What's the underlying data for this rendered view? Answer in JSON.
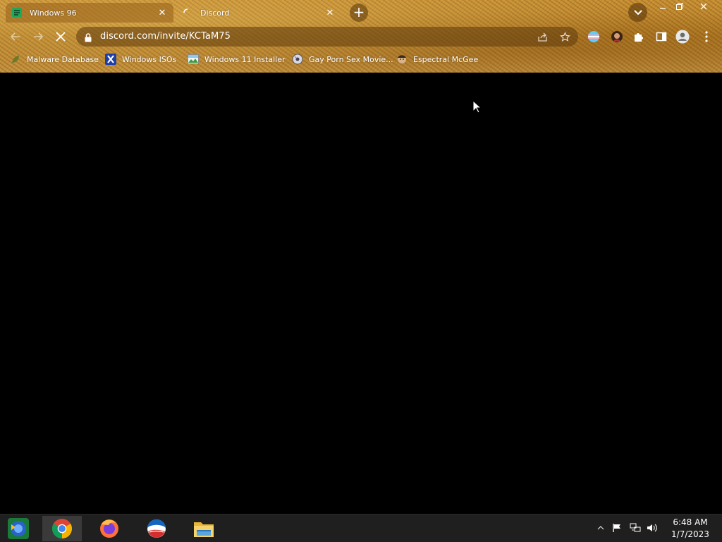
{
  "browser": {
    "tabs": [
      {
        "title": "Windows 96",
        "active": true,
        "icon": "windows96-icon"
      },
      {
        "title": "Discord",
        "active": false,
        "icon": "loading-spinner-icon"
      }
    ],
    "new_tab_symbol": "+",
    "address_bar": {
      "url": "discord.com/invite/KCTaM75"
    },
    "bookmarks": [
      {
        "label": "Malware Database",
        "icon": "leaf-icon"
      },
      {
        "label": "Windows ISOs",
        "icon": "x-logo-icon"
      },
      {
        "label": "Windows 11 Installer",
        "icon": "picture-icon"
      },
      {
        "label": "Gay Porn Sex Movie...",
        "icon": "disc-icon"
      },
      {
        "label": "Espectral McGee",
        "icon": "avatar-face-icon"
      }
    ]
  },
  "taskbar": {
    "apps": [
      "Google Chrome",
      "Firefox",
      "Obama app",
      "File Explorer"
    ],
    "clock": {
      "time": "6:48 AM",
      "date": "1/7/2023"
    }
  },
  "colors": {
    "chrome_base": "#b07a25",
    "content_bg": "#000000",
    "taskbar_bg": "#1f1f1f"
  }
}
